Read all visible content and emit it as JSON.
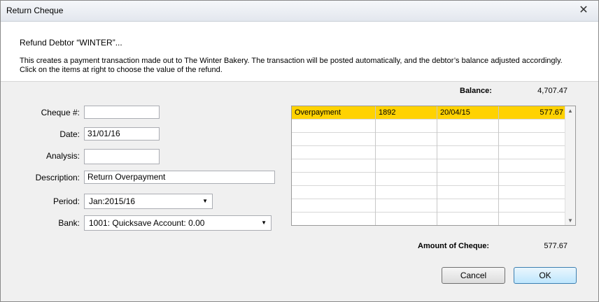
{
  "window": {
    "title": "Return Cheque",
    "close_glyph": "✕"
  },
  "header": {
    "heading": "Refund Debtor “WINTER”...",
    "description": "This creates a payment transaction made out to The Winter Bakery. The transaction will be posted automatically, and the debtor’s balance adjusted accordingly. Click on the items at right to choose the value of the refund."
  },
  "form": {
    "cheque_label": "Cheque #:",
    "cheque_value": "",
    "date_label": "Date:",
    "date_value": "31/01/16",
    "analysis_label": "Analysis:",
    "analysis_value": "",
    "description_label": "Description:",
    "description_value": "Return Overpayment",
    "period_label": "Period:",
    "period_value": "Jan:2015/16",
    "bank_label": "Bank:",
    "bank_value": "1001: Quicksave Account: 0.00"
  },
  "balance": {
    "label": "Balance:",
    "value": "4,707.47"
  },
  "grid": {
    "rows": [
      {
        "type": "Overpayment",
        "ref": "1892",
        "date": "20/04/15",
        "amount": "577.67"
      }
    ]
  },
  "amount": {
    "label": "Amount of Cheque:",
    "value": "577.67"
  },
  "buttons": {
    "cancel": "Cancel",
    "ok": "OK"
  },
  "icons": {
    "dropdown": "▼",
    "scroll_up": "▲",
    "scroll_down": "▼"
  }
}
